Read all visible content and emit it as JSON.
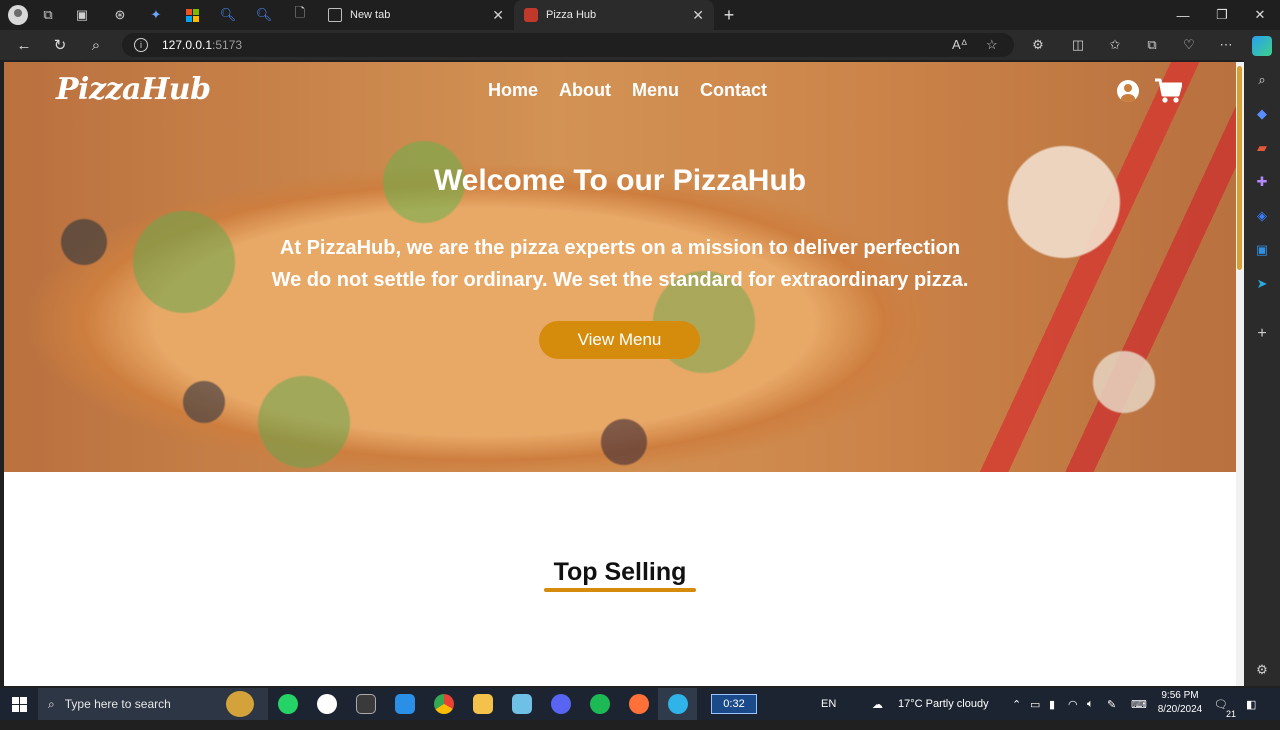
{
  "browser": {
    "tabs": [
      {
        "title": "New tab",
        "active": false
      },
      {
        "title": "Pizza Hub",
        "active": true
      }
    ],
    "url_host": "127.0.0.1",
    "url_port": ":5173"
  },
  "site": {
    "logo": "PizzaHub",
    "nav": [
      "Home",
      "About",
      "Menu",
      "Contact"
    ],
    "hero_title": "Welcome To our PizzaHub",
    "hero_line1": "At PizzaHub, we are the pizza experts on a mission to deliver perfection",
    "hero_line2": "We do not settle for ordinary. We set the standard for extraordinary pizza.",
    "cta_label": "View Menu",
    "section_title": "Top Selling",
    "accent_color": "#d58b0b"
  },
  "taskbar": {
    "search_placeholder": "Type here to search",
    "media_time": "0:32",
    "language": "EN",
    "weather": "17°C  Partly cloudy",
    "time": "9:56 PM",
    "date": "8/20/2024",
    "notifications": "21"
  }
}
